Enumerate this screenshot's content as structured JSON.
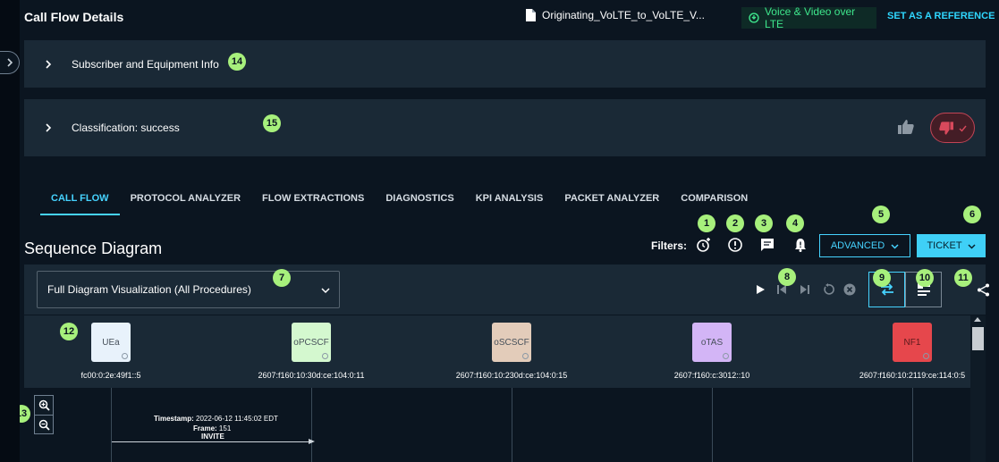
{
  "header": {
    "title": "Call Flow Details",
    "file_name": "Originating_VoLTE_to_VoLTE_V...",
    "technology": "Voice & Video over LTE",
    "reference_link": "SET AS A REFERENCE"
  },
  "panels": {
    "subscriber": {
      "label": "Subscriber and Equipment Info",
      "badge": "14"
    },
    "classification": {
      "label": "Classification: success",
      "badge": "15"
    }
  },
  "tabs": [
    "CALL FLOW",
    "PROTOCOL ANALYZER",
    "FLOW EXTRACTIONS",
    "DIAGNOSTICS",
    "KPI ANALYSIS",
    "PACKET ANALYZER",
    "COMPARISON"
  ],
  "sequence": {
    "title": "Sequence Diagram",
    "filters_label": "Filters:",
    "filter_badges": [
      "1",
      "2",
      "3",
      "4"
    ],
    "advanced_label": "ADVANCED",
    "advanced_badge": "5",
    "ticket_label": "TICKET",
    "ticket_badge": "6"
  },
  "toolbar": {
    "select_value": "Full Diagram Visualization (All Procedures)",
    "select_badge": "7",
    "playback_badge": "8",
    "swap_badge": "9",
    "layout_badge": "10",
    "share_badge": "11"
  },
  "nodes": {
    "badge": "12",
    "items": [
      {
        "name": "UEa",
        "ip": "fc00:0:2e:49f1::5",
        "color": "#e8f2fb"
      },
      {
        "name": "oPCSCF",
        "ip": "2607:f160:10:30d:ce:104:0:11",
        "color": "#d4f8cf"
      },
      {
        "name": "oSCSCF",
        "ip": "2607:f160:10:230d:ce:104:0:15",
        "color": "#e3ccba"
      },
      {
        "name": "oTAS",
        "ip": "2607:f160:c:3012::10",
        "color": "#d3b5f6"
      },
      {
        "name": "NF1",
        "ip": "2607:f160:10:2119:ce:114:0:5",
        "color": "#e6474c"
      }
    ]
  },
  "diagram": {
    "zoom_badge": "13",
    "message": {
      "timestamp_label": "Timestamp:",
      "timestamp": "2022-06-12 11:45:02 EDT",
      "frame_label": "Frame:",
      "frame": "151",
      "name": "INVITE"
    }
  },
  "colors": {
    "accent": "#46d3ff",
    "badge": "#a7f07c",
    "thumb_down": "#c24455",
    "technology": "#3ee58c"
  }
}
